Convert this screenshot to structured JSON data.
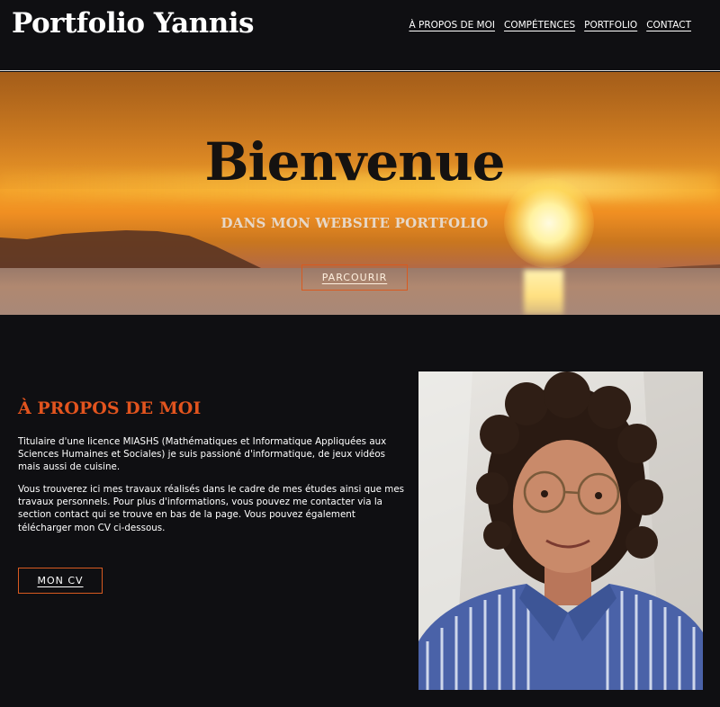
{
  "header": {
    "logo": "Portfolio Yannis",
    "nav": [
      {
        "label": "À PROPOS DE MOI"
      },
      {
        "label": "COMPÉTENCES"
      },
      {
        "label": "PORTFOLIO"
      },
      {
        "label": "CONTACT"
      }
    ]
  },
  "hero": {
    "title": "Bienvenue",
    "subtitle": "DANS MON WEBSITE PORTFOLIO",
    "button": "PARCOURIR"
  },
  "about": {
    "title": "À PROPOS DE MOI",
    "paragraph1": "Titulaire d'une licence MIASHS (Mathématiques et Informatique Appliquées aux Sciences Humaines et Sociales) je suis passioné d'informatique, de jeux vidéos mais aussi de cuisine.",
    "paragraph2": "Vous trouverez ici mes travaux réalisés dans le cadre de mes études ainsi que mes travaux personnels. Pour plus d'informations, vous pouvez me contacter via la section contact qui se trouve en bas de la page. Vous pouvez également télécharger mon CV ci-dessous.",
    "cv_button": "MON CV"
  },
  "colors": {
    "background": "#0f0f12",
    "accent": "#e2541e",
    "text": "#ffffff"
  }
}
